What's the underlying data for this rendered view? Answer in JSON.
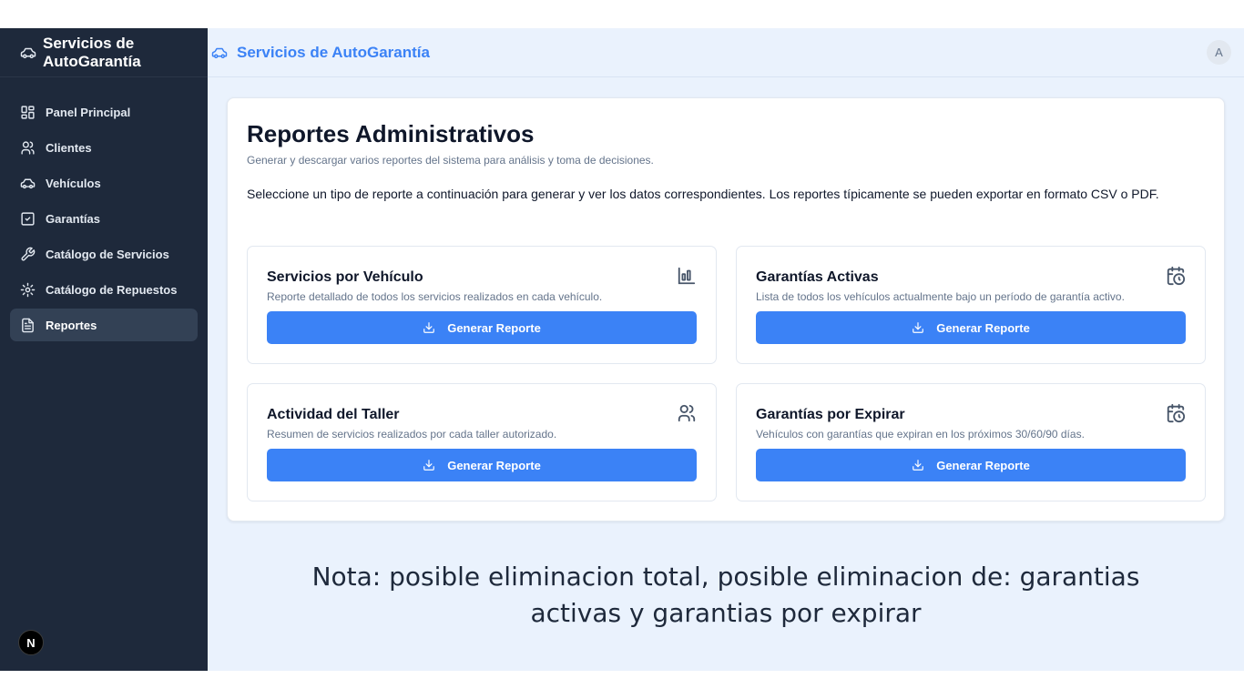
{
  "sidebar": {
    "brand": "Servicios de AutoGarantía",
    "items": [
      {
        "label": "Panel Principal",
        "icon": "dashboard-icon"
      },
      {
        "label": "Clientes",
        "icon": "users-icon"
      },
      {
        "label": "Vehículos",
        "icon": "car-icon"
      },
      {
        "label": "Garantías",
        "icon": "checkbox-icon"
      },
      {
        "label": "Catálogo de Servicios",
        "icon": "wrench-icon"
      },
      {
        "label": "Catálogo de Repuestos",
        "icon": "gear-icon"
      },
      {
        "label": "Reportes",
        "icon": "document-icon",
        "active": true
      }
    ],
    "footer_badge": "N"
  },
  "header": {
    "title": "Servicios de AutoGarantía",
    "avatar": "A"
  },
  "reports": {
    "title": "Reportes Administrativos",
    "subtitle": "Generar y descargar varios reportes del sistema para análisis y toma de decisiones.",
    "description": "Seleccione un tipo de reporte a continuación para generar y ver los datos correspondientes. Los reportes típicamente se pueden exportar en formato CSV o PDF.",
    "cards": [
      {
        "title": "Servicios por Vehículo",
        "description": "Reporte detallado de todos los servicios realizados en cada vehículo.",
        "button": "Generar Reporte",
        "icon": "bar-chart-icon"
      },
      {
        "title": "Garantías Activas",
        "description": "Lista de todos los vehículos actualmente bajo un período de garantía activo.",
        "button": "Generar Reporte",
        "icon": "calendar-clock-icon"
      },
      {
        "title": "Actividad del Taller",
        "description": "Resumen de servicios realizados por cada taller autorizado.",
        "button": "Generar Reporte",
        "icon": "users-icon"
      },
      {
        "title": "Garantías por Expirar",
        "description": "Vehículos con garantías que expiran en los próximos 30/60/90 días.",
        "button": "Generar Reporte",
        "icon": "calendar-clock-icon"
      }
    ]
  },
  "note": {
    "line1": "Nota: posible eliminacion total, posible eliminacion de: garantias",
    "line2": "activas y garantias por expirar"
  },
  "colors": {
    "sidebar_bg": "#1e293b",
    "accent": "#3b82f6",
    "main_bg": "#eaf2fd"
  }
}
